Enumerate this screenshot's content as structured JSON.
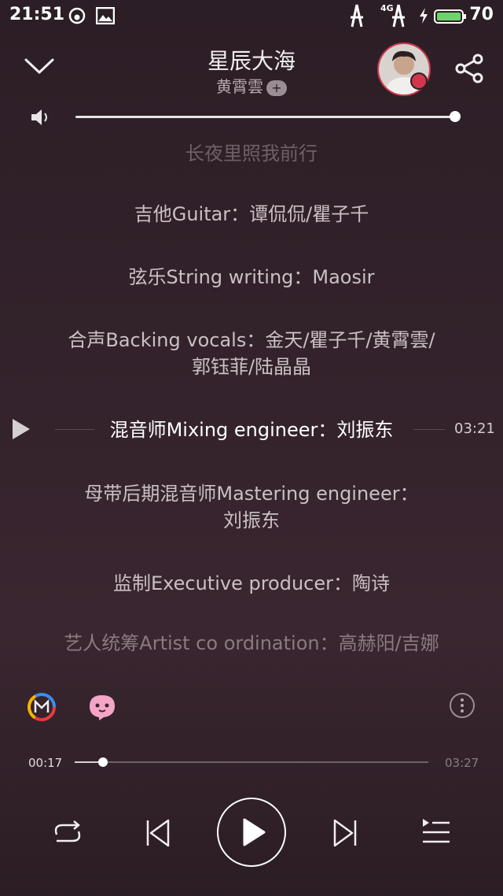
{
  "status_bar": {
    "time": "21:51",
    "battery": "70",
    "network": "4G"
  },
  "header": {
    "title": "星辰大海",
    "artist": "黄霄雲",
    "add_badge": "+"
  },
  "volume": {
    "level": 1.0
  },
  "lyrics": [
    {
      "text": "长夜里照我前行",
      "style": "dim"
    },
    {
      "text": "吉他Guitar：谭侃侃/瞿子千",
      "style": "normal"
    },
    {
      "text": "弦乐String writing：Maosir",
      "style": "normal"
    },
    {
      "text": "合声Backing vocals：金天/瞿子千/黄霄雲/",
      "style": "normal"
    },
    {
      "text": "郭钰菲/陆晶晶",
      "style": "normal"
    },
    {
      "text": "混音师Mixing engineer：刘振东",
      "style": "current"
    },
    {
      "text": "母带后期混音师Mastering engineer：",
      "style": "normal"
    },
    {
      "text": "刘振东",
      "style": "normal"
    },
    {
      "text": "监制Executive producer：陶诗",
      "style": "normal"
    },
    {
      "text": "艺人统筹Artist co ordination：高赫阳/吉娜",
      "style": "faint"
    }
  ],
  "current_line_time": "03:21",
  "playback": {
    "elapsed": "00:17",
    "total": "03:27",
    "progress": 0.08
  },
  "icons": {
    "collapse": "chevron-down-icon",
    "share": "share-icon",
    "volume": "speaker-icon",
    "play_from_line": "play-triangle-icon",
    "brand_m": "m-logo-icon",
    "mascot": "mascot-icon",
    "more": "more-vertical-icon",
    "repeat": "repeat-icon",
    "previous": "previous-icon",
    "play": "play-icon",
    "next": "next-icon",
    "playlist": "playlist-icon"
  },
  "colors": {
    "accent": "#d2364a",
    "background": "#33222b"
  }
}
